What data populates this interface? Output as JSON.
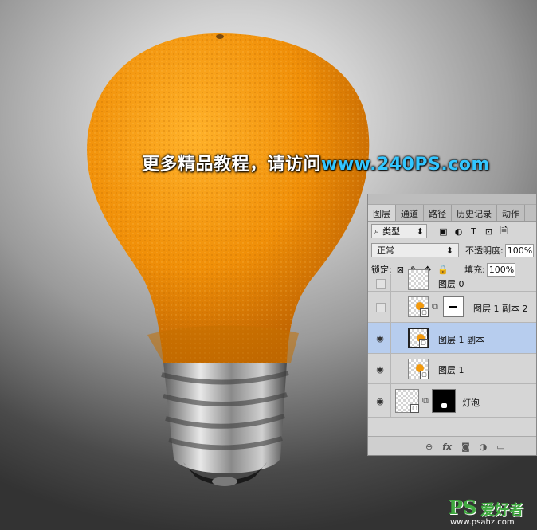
{
  "watermark": {
    "text": "更多精品教程，请访问",
    "url": "www.240PS.com"
  },
  "logo": {
    "mark": "PS",
    "cn": "爱好者",
    "url": "www.psahz.com"
  },
  "layers_panel": {
    "tabs": [
      {
        "label": "图层",
        "active": true
      },
      {
        "label": "通道",
        "active": false
      },
      {
        "label": "路径",
        "active": false
      },
      {
        "label": "历史记录",
        "active": false
      },
      {
        "label": "动作",
        "active": false
      }
    ],
    "filter": {
      "icon": "search-icon",
      "label": "类型"
    },
    "filter_icons": [
      "image-filter-icon",
      "adjustment-filter-icon",
      "type-filter-icon",
      "shape-filter-icon",
      "smart-object-filter-icon"
    ],
    "blend_mode": "正常",
    "opacity_label": "不透明度:",
    "opacity_value": "100%",
    "lock_label": "锁定:",
    "fill_label": "填充:",
    "fill_value": "100%",
    "layers": [
      {
        "name": "图层 0",
        "visible": false,
        "selected": false,
        "has_mask": false
      },
      {
        "name": "图层 1 副本 2",
        "visible": false,
        "selected": false,
        "has_mask": true,
        "mask": "white"
      },
      {
        "name": "图层 1 副本",
        "visible": true,
        "selected": true,
        "has_mask": false
      },
      {
        "name": "图层 1",
        "visible": true,
        "selected": false,
        "has_mask": false
      },
      {
        "name": "灯泡",
        "visible": true,
        "selected": false,
        "has_mask": true,
        "mask": "black"
      }
    ],
    "bottom_icons": [
      "link-layers-icon",
      "fx-icon",
      "add-mask-icon",
      "adjustment-layer-icon",
      "new-group-icon"
    ]
  }
}
